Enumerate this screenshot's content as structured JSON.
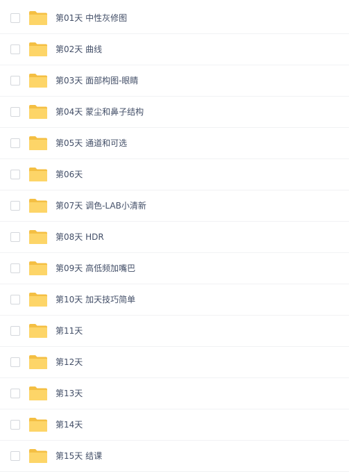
{
  "colors": {
    "folder_back": "#f4bf43",
    "folder_front": "#fdd568",
    "text": "#424e67",
    "divider": "#f1f2f4",
    "checkbox_border": "#d4d7dc"
  },
  "items": [
    {
      "name": "第01天 中性灰修图",
      "checked": false,
      "icon": "folder-icon"
    },
    {
      "name": "第02天 曲线",
      "checked": false,
      "icon": "folder-icon"
    },
    {
      "name": "第03天 面部构图-眼睛",
      "checked": false,
      "icon": "folder-icon"
    },
    {
      "name": "第04天 蒙尘和鼻子结构",
      "checked": false,
      "icon": "folder-icon"
    },
    {
      "name": "第05天 通道和可选",
      "checked": false,
      "icon": "folder-icon"
    },
    {
      "name": "第06天",
      "checked": false,
      "icon": "folder-icon"
    },
    {
      "name": "第07天 调色-LAB小清新",
      "checked": false,
      "icon": "folder-icon"
    },
    {
      "name": "第08天 HDR",
      "checked": false,
      "icon": "folder-icon"
    },
    {
      "name": "第09天 高低频加嘴巴",
      "checked": false,
      "icon": "folder-icon"
    },
    {
      "name": "第10天 加天技巧简单",
      "checked": false,
      "icon": "folder-icon"
    },
    {
      "name": "第11天",
      "checked": false,
      "icon": "folder-icon"
    },
    {
      "name": "第12天",
      "checked": false,
      "icon": "folder-icon"
    },
    {
      "name": "第13天",
      "checked": false,
      "icon": "folder-icon"
    },
    {
      "name": "第14天",
      "checked": false,
      "icon": "folder-icon"
    },
    {
      "name": "第15天 结课",
      "checked": false,
      "icon": "folder-icon"
    }
  ]
}
